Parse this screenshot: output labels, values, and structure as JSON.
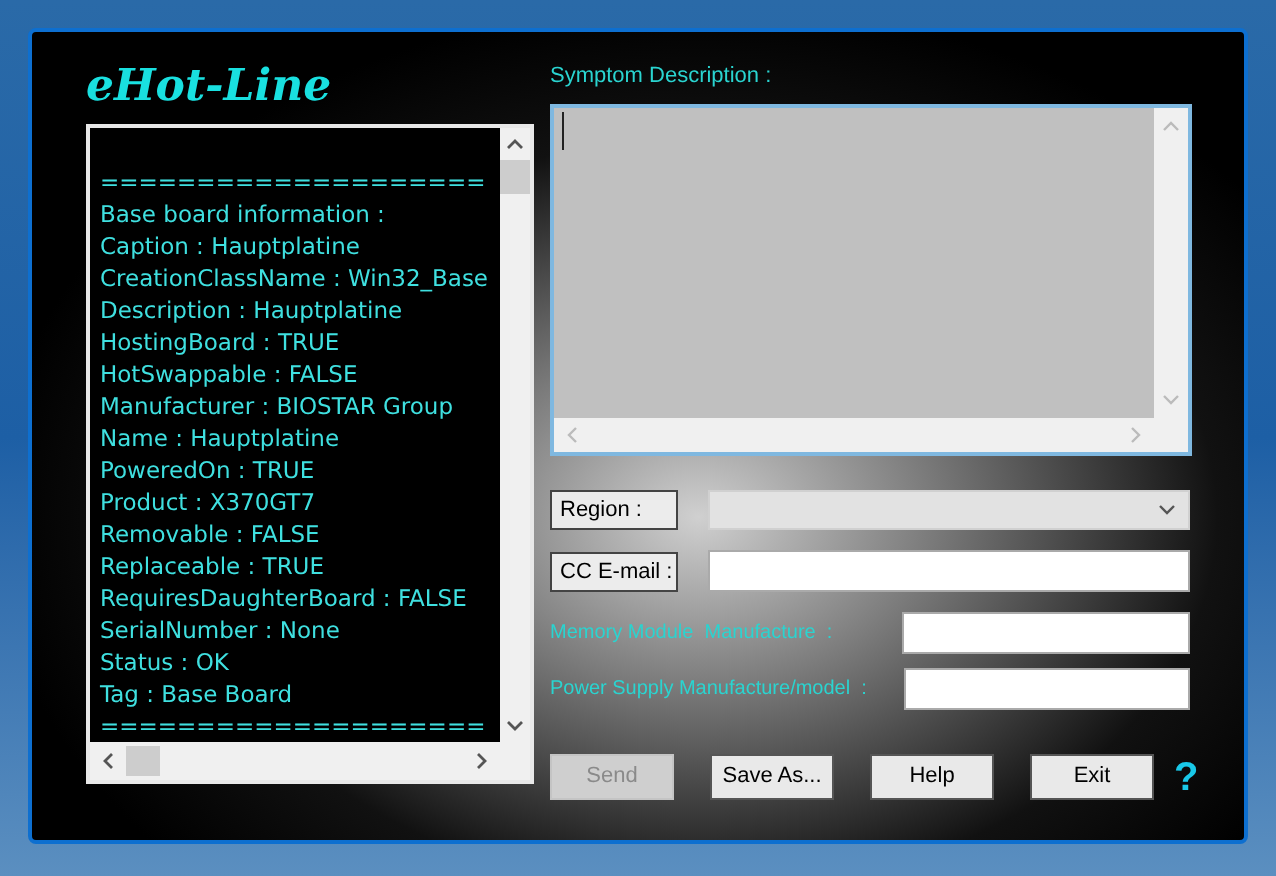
{
  "app_title": "eHot-Line",
  "info_log": [
    "====================",
    "Base board information :",
    "Caption : Hauptplatine",
    "CreationClassName : Win32_Base",
    "Description : Hauptplatine",
    "HostingBoard : TRUE",
    "HotSwappable : FALSE",
    "Manufacturer : BIOSTAR Group",
    "Name : Hauptplatine",
    "PoweredOn : TRUE",
    "Product : X370GT7",
    "Removable : FALSE",
    "Replaceable : TRUE",
    "RequiresDaughterBoard : FALSE",
    "SerialNumber : None",
    "Status : OK",
    "Tag : Base Board",
    "===================="
  ],
  "symptom_label": "Symptom Description :",
  "region_label": "Region :",
  "cc_email_label": "CC E-mail :",
  "memory_label": "Memory Module  Manufacture  :",
  "power_label": "Power Supply Manufacture/model  :",
  "buttons": [
    {
      "label": "Send",
      "disabled": true
    },
    {
      "label": "Save As...",
      "disabled": false
    },
    {
      "label": "Help",
      "disabled": false
    },
    {
      "label": "Exit",
      "disabled": false
    }
  ],
  "help_mark": "?"
}
